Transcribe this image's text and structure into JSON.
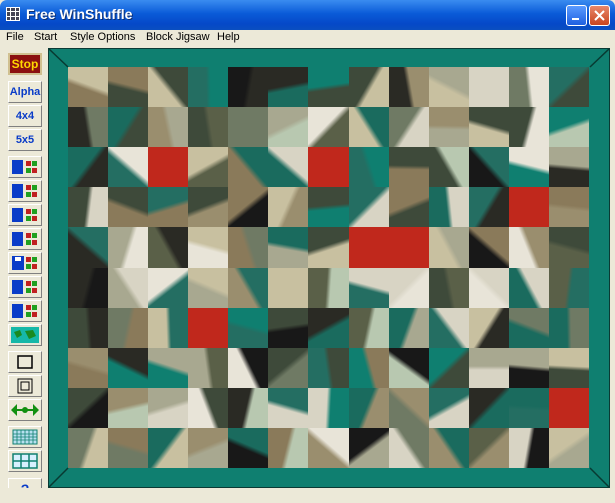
{
  "window": {
    "title": "Free WinShuffle"
  },
  "menu": [
    "File",
    "Start",
    "Style Options",
    "Block Jigsaw",
    "Help"
  ],
  "toolbar": {
    "stop": "Stop",
    "alpha": "Alpha",
    "grid4": "4x4",
    "grid5": "5x5",
    "help": "?"
  },
  "board": {
    "rows": 10,
    "cols": 13
  },
  "colors": {
    "teal": "#0f7f70",
    "dark": "#1c1c1c",
    "red": "#c0281c"
  }
}
